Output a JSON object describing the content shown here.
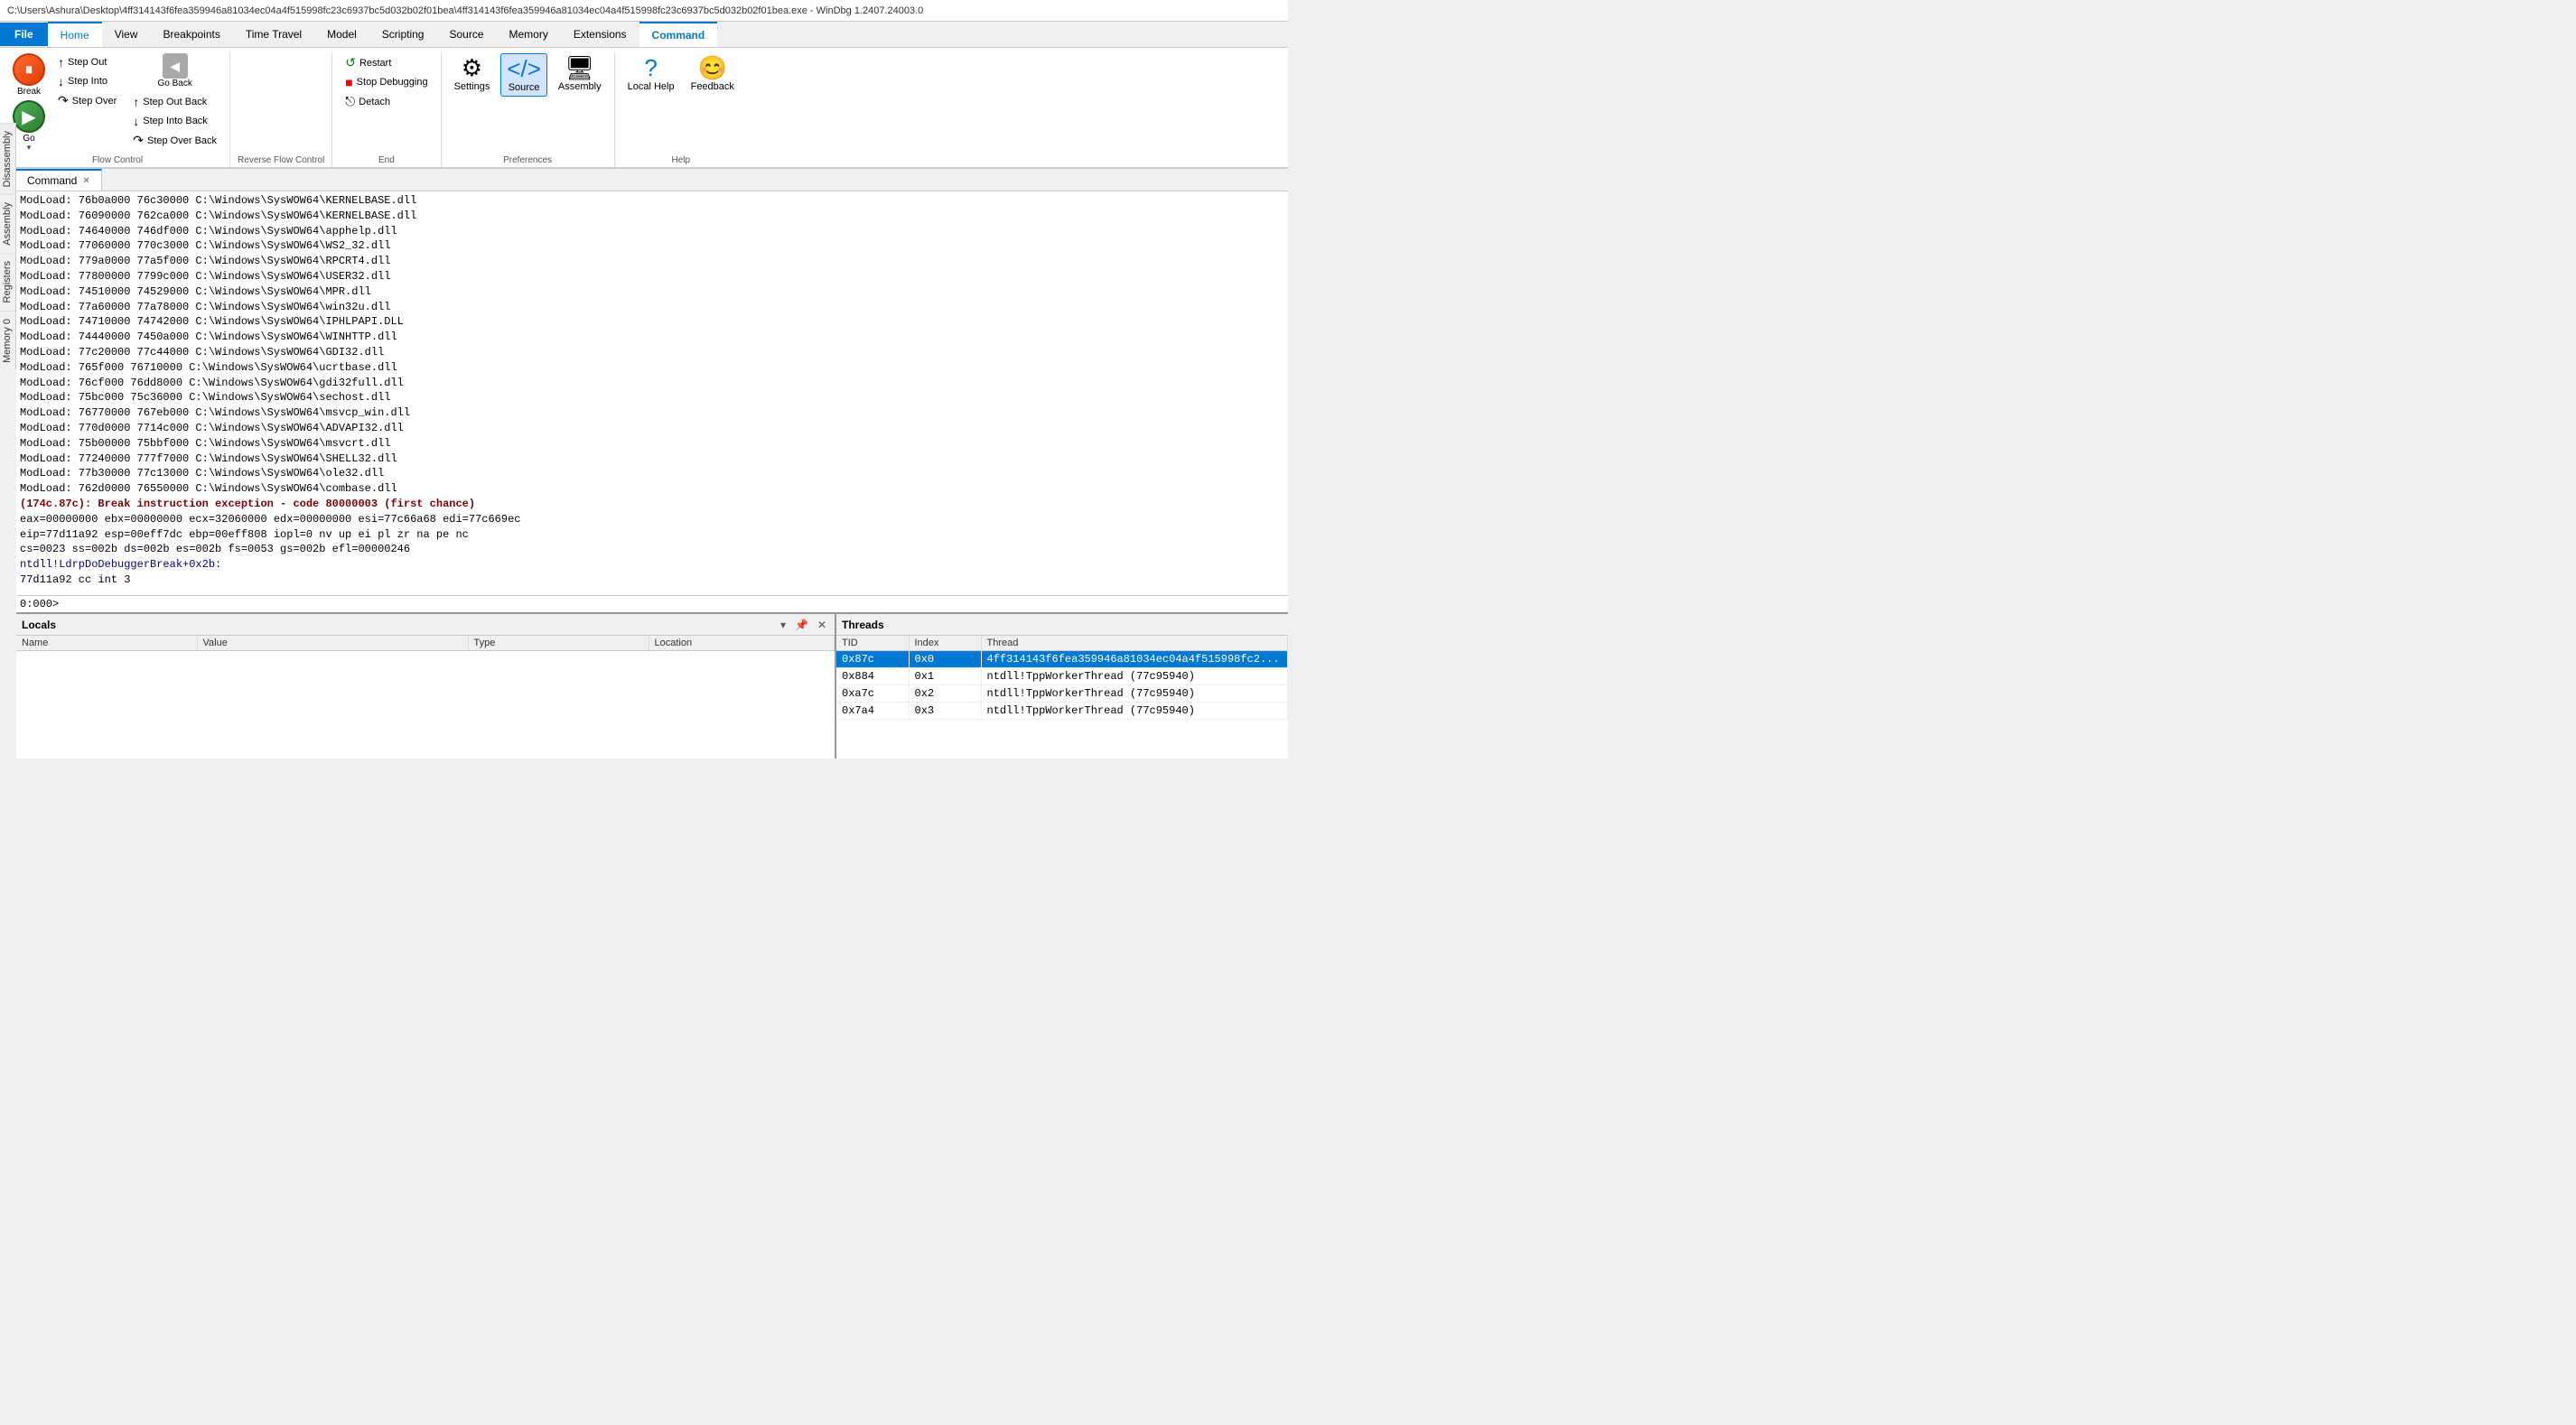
{
  "titlebar": {
    "text": "C:\\Users\\Ashura\\Desktop\\4ff314143f6fea359946a81034ec04a4f515998fc23c6937bc5d032b02f01bea\\4ff314143f6fea359946a81034ec04a4f515998fc23c6937bc5d032b02f01bea.exe - WinDbg 1.2407.24003.0"
  },
  "menu": {
    "items": [
      {
        "id": "file",
        "label": "File",
        "active": false
      },
      {
        "id": "home",
        "label": "Home",
        "active": true
      },
      {
        "id": "view",
        "label": "View",
        "active": false
      },
      {
        "id": "breakpoints",
        "label": "Breakpoints",
        "active": false
      },
      {
        "id": "time-travel",
        "label": "Time Travel",
        "active": false
      },
      {
        "id": "model",
        "label": "Model",
        "active": false
      },
      {
        "id": "scripting",
        "label": "Scripting",
        "active": false
      },
      {
        "id": "source",
        "label": "Source",
        "active": false
      },
      {
        "id": "memory",
        "label": "Memory",
        "active": false
      },
      {
        "id": "extensions",
        "label": "Extensions",
        "active": false
      },
      {
        "id": "command",
        "label": "Command",
        "active": true
      }
    ]
  },
  "ribbon": {
    "flow_control": {
      "label": "Flow Control",
      "break_label": "Break",
      "go_label": "Go",
      "step_out_label": "Step Out",
      "step_into_label": "Step Into",
      "step_over_label": "Step Over",
      "step_out_back_label": "Step Out Back",
      "step_into_back_label": "Step Into Back",
      "step_over_back_label": "Step Over Back",
      "go_back_label": "Go Back"
    },
    "reverse_flow": {
      "label": "Reverse Flow Control"
    },
    "end": {
      "label": "End",
      "restart_label": "Restart",
      "stop_debugging_label": "Stop Debugging",
      "detach_label": "Detach"
    },
    "preferences": {
      "label": "Preferences",
      "settings_label": "Settings",
      "source_label": "Source",
      "assembly_label": "Assembly"
    },
    "help": {
      "label": "Help",
      "local_help_label": "Local Help",
      "feedback_label": "Feedback"
    }
  },
  "sidebar": {
    "tabs": [
      "Disassembly",
      "Assembly",
      "Registers",
      "Memory 0"
    ]
  },
  "command": {
    "tab_label": "Command",
    "output_lines": [
      "ModLoad: 76b0a000 76c30000   C:\\Windows\\SysWOW64\\KERNELBASE.dll",
      "ModLoad: 76090000 762ca000   C:\\Windows\\SysWOW64\\KERNELBASE.dll",
      "ModLoad: 74640000 746df000   C:\\Windows\\SysWOW64\\apphelp.dll",
      "ModLoad: 77060000 770c3000   C:\\Windows\\SysWOW64\\WS2_32.dll",
      "ModLoad: 779a0000 77a5f000   C:\\Windows\\SysWOW64\\RPCRT4.dll",
      "ModLoad: 77800000 7799c000   C:\\Windows\\SysWOW64\\USER32.dll",
      "ModLoad: 74510000 74529000   C:\\Windows\\SysWOW64\\MPR.dll",
      "ModLoad: 77a60000 77a78000   C:\\Windows\\SysWOW64\\win32u.dll",
      "ModLoad: 74710000 74742000   C:\\Windows\\SysWOW64\\IPHLPAPI.DLL",
      "ModLoad: 74440000 7450a000   C:\\Windows\\SysWOW64\\WINHTTP.dll",
      "ModLoad: 77c20000 77c44000   C:\\Windows\\SysWOW64\\GDI32.dll",
      "ModLoad: 765f000 76710000   C:\\Windows\\SysWOW64\\ucrtbase.dll",
      "ModLoad: 76cf000 76dd8000   C:\\Windows\\SysWOW64\\gdi32full.dll",
      "ModLoad: 75bc000 75c36000   C:\\Windows\\SysWOW64\\sechost.dll",
      "ModLoad: 76770000 767eb000   C:\\Windows\\SysWOW64\\msvcp_win.dll",
      "ModLoad: 770d0000 7714c000   C:\\Windows\\SysWOW64\\ADVAPI32.dll",
      "ModLoad: 75b00000 75bbf000   C:\\Windows\\SysWOW64\\msvcrt.dll",
      "ModLoad: 77240000 777f7000   C:\\Windows\\SysWOW64\\SHELL32.dll",
      "ModLoad: 77b30000 77c13000   C:\\Windows\\SysWOW64\\ole32.dll",
      "ModLoad: 762d0000 76550000   C:\\Windows\\SysWOW64\\combase.dll",
      "(174c.87c): Break instruction exception - code 80000003 (first chance)",
      "eax=00000000 ebx=00000000 ecx=32060000 edx=00000000 esi=77c66a68 edi=77c669ec",
      "eip=77d11a92 esp=00eff7dc ebp=00eff808 iopl=0         nv up ei pl zr na pe nc",
      "cs=0023  ss=002b  ds=002b  es=002b  fs=0053  gs=002b             efl=00000246",
      "ntdll!LdrpDoDebuggerBreak+0x2b:",
      "77d11a92 cc              int     3"
    ],
    "prompt": "0:000>",
    "input_placeholder": ""
  },
  "locals": {
    "title": "Locals",
    "columns": [
      "Name",
      "Value",
      "Type",
      "Location"
    ]
  },
  "threads": {
    "title": "Threads",
    "columns": [
      "TID",
      "Index",
      "Thread"
    ],
    "rows": [
      {
        "tid": "0x87c",
        "index": "0x0",
        "thread": "4ff314143f6fea359946a81034ec04a4f515998fc2...",
        "highlighted": true
      },
      {
        "tid": "0x884",
        "index": "0x1",
        "thread": "ntdll!TppWorkerThread (77c95940)",
        "highlighted": false
      },
      {
        "tid": "0xa7c",
        "index": "0x2",
        "thread": "ntdll!TppWorkerThread (77c95940)",
        "highlighted": false
      },
      {
        "tid": "0x7a4",
        "index": "0x3",
        "thread": "ntdll!TppWorkerThread (77c95940)",
        "highlighted": false
      }
    ]
  }
}
